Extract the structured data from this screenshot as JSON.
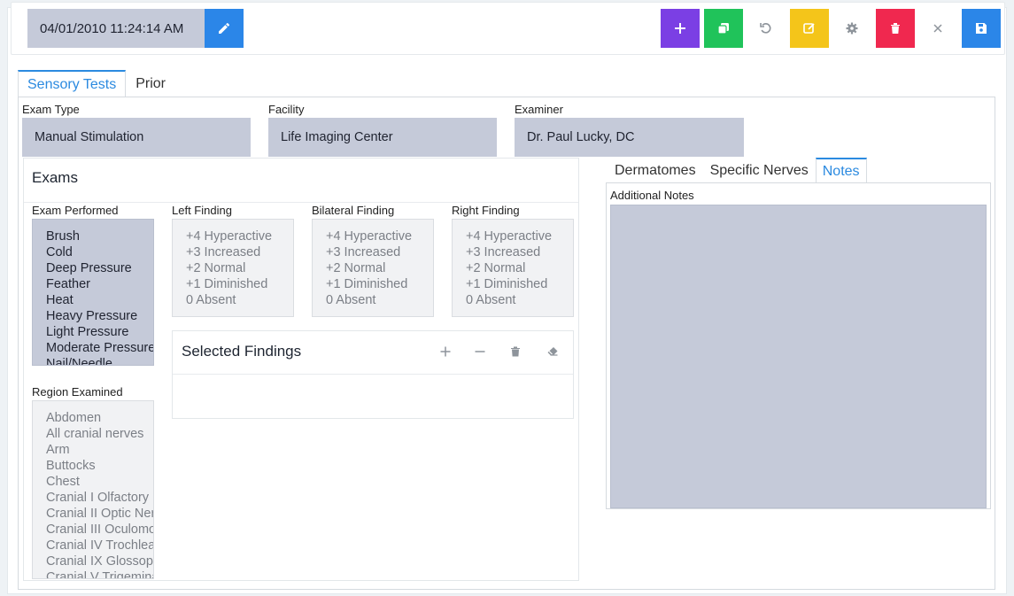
{
  "toolbar": {
    "datetime": "04/01/2010 11:24:14 AM",
    "colors": {
      "edit": "#2b86e8",
      "add": "#7b3fe4",
      "copy": "#20c35a",
      "compose": "#f4c51a",
      "delete": "#f0284f",
      "save": "#2b86e8"
    },
    "icons": [
      "pencil-icon",
      "plus-icon",
      "copy-icon",
      "undo-icon",
      "edit-icon",
      "gear-icon",
      "trash-icon",
      "close-icon",
      "save-icon"
    ]
  },
  "tabs": {
    "main": [
      "Sensory Tests",
      "Prior"
    ],
    "right": [
      "Dermatomes",
      "Specific Nerves",
      "Notes"
    ]
  },
  "fields": {
    "exam_type": {
      "label": "Exam Type",
      "value": "Manual Stimulation"
    },
    "facility": {
      "label": "Facility",
      "value": "Life Imaging Center"
    },
    "examiner": {
      "label": "Examiner",
      "value": "Dr. Paul Lucky, DC"
    }
  },
  "exams": {
    "title": "Exams",
    "exam_performed": {
      "label": "Exam Performed",
      "items": [
        "Brush",
        "Cold",
        "Deep Pressure",
        "Feather",
        "Heat",
        "Heavy Pressure",
        "Light Pressure",
        "Moderate Pressure",
        "Nail/Needle"
      ]
    },
    "left_finding": {
      "label": "Left Finding",
      "items": [
        "+4 Hyperactive",
        "+3 Increased",
        "+2 Normal",
        "+1 Diminished",
        "0 Absent"
      ]
    },
    "bilateral_finding": {
      "label": "Bilateral Finding",
      "items": [
        "+4 Hyperactive",
        "+3 Increased",
        "+2 Normal",
        "+1 Diminished",
        "0 Absent"
      ]
    },
    "right_finding": {
      "label": "Right Finding",
      "items": [
        "+4 Hyperactive",
        "+3 Increased",
        "+2 Normal",
        "+1 Diminished",
        "0 Absent"
      ]
    },
    "region_examined": {
      "label": "Region Examined",
      "items": [
        "Abdomen",
        "All cranial nerves",
        "Arm",
        "Buttocks",
        "Chest",
        "Cranial I Olfactory",
        "Cranial II Optic Nerve",
        "Cranial III Oculomotor",
        "Cranial IV Trochlear",
        "Cranial IX Glossopharyngeal",
        "Cranial V Trigeminal"
      ]
    },
    "selected_findings": {
      "title": "Selected Findings"
    }
  },
  "notes": {
    "label": "Additional Notes",
    "value": ""
  }
}
